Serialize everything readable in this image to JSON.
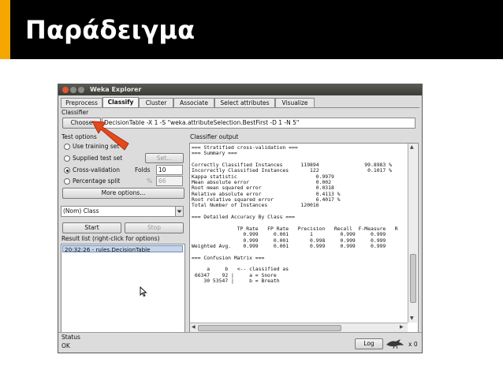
{
  "slide": {
    "title": "Παράδειγμα",
    "accent_color": "#f5a700"
  },
  "window": {
    "title": "Weka Explorer",
    "tabs": [
      "Preprocess",
      "Classify",
      "Cluster",
      "Associate",
      "Select attributes",
      "Visualize"
    ],
    "active_tab": "Classify"
  },
  "classifier": {
    "label": "Classifier",
    "choose_label": "Choose",
    "spec": "DecisionTable -X 1 -S \"weka.attributeSelection.BestFirst -D 1 -N 5\""
  },
  "test_options": {
    "label": "Test options",
    "use_training": "Use training set",
    "supplied": "Supplied test set",
    "set_button": "Set...",
    "cross_validation": "Cross-validation",
    "folds_label": "Folds",
    "folds_value": "10",
    "percentage_split": "Percentage split",
    "percent_sign": "%",
    "percent_value": "66",
    "more_options": "More options...",
    "selected": "Cross-validation"
  },
  "class_select": {
    "value": "(Nom) Class"
  },
  "actions": {
    "start": "Start",
    "stop": "Stop"
  },
  "result_list": {
    "label": "Result list (right-click for options)",
    "items": [
      "20:32:26 - rules.DecisionTable"
    ]
  },
  "output": {
    "label": "Classifier output",
    "lines": [
      "=== Stratified cross-validation ===",
      "=== Summary ===",
      "",
      "Correctly Classified Instances      119894               99.8983 %",
      "Incorrectly Classified Instances       122                0.1017 %",
      "Kappa statistic                          0.9979",
      "Mean absolute error                      0.002",
      "Root mean squared error                  0.0318",
      "Relative absolute error                  0.4113 %",
      "Root relative squared error              6.4017 %",
      "Total Number of Instances           120016",
      "",
      "=== Detailed Accuracy By Class ===",
      "",
      "               TP Rate   FP Rate   Precision   Recall  F-Measure   R",
      "                 0.999     0.001       1         0.999     0.999",
      "                 0.999     0.001       0.998     0.999     0.999",
      "Weighted Avg.    0.999     0.001       0.999     0.999     0.999",
      "",
      "=== Confusion Matrix ===",
      "",
      "     a     b   <-- classified as",
      " 66347    92 |     a = Snore",
      "    30 53547 |     b = Breath"
    ]
  },
  "status": {
    "label": "Status",
    "value": "OK",
    "log_button": "Log",
    "count": "x 0"
  }
}
